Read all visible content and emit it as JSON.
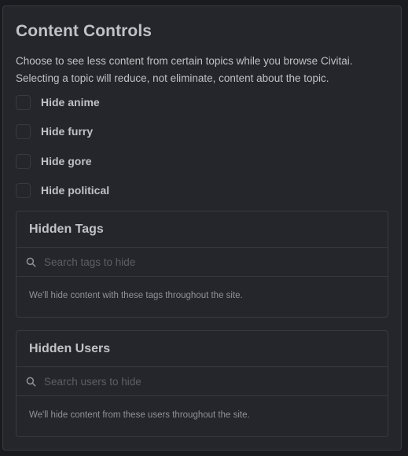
{
  "content_controls": {
    "title": "Content Controls",
    "description_lines": [
      "Choose to see less content from certain topics while you browse Civitai.",
      "Selecting a topic will reduce, not eliminate, content about the topic."
    ],
    "toggles": [
      {
        "label": "Hide anime",
        "checked": false
      },
      {
        "label": "Hide furry",
        "checked": false
      },
      {
        "label": "Hide gore",
        "checked": false
      },
      {
        "label": "Hide political",
        "checked": false
      }
    ]
  },
  "hidden_tags": {
    "title": "Hidden Tags",
    "search_icon": "search-icon",
    "placeholder": "Search tags to hide",
    "value": "",
    "note": "We'll hide content with these tags throughout the site."
  },
  "hidden_users": {
    "title": "Hidden Users",
    "search_icon": "search-icon",
    "placeholder": "Search users to hide",
    "value": "",
    "note": "We'll hide content from these users throughout the site."
  },
  "colors": {
    "page_background": "#1a1b1e",
    "panel_background": "#25262b",
    "border": "#373a40",
    "text": "#c1c2c5",
    "muted_text": "#909296",
    "placeholder": "#5c5f66"
  }
}
